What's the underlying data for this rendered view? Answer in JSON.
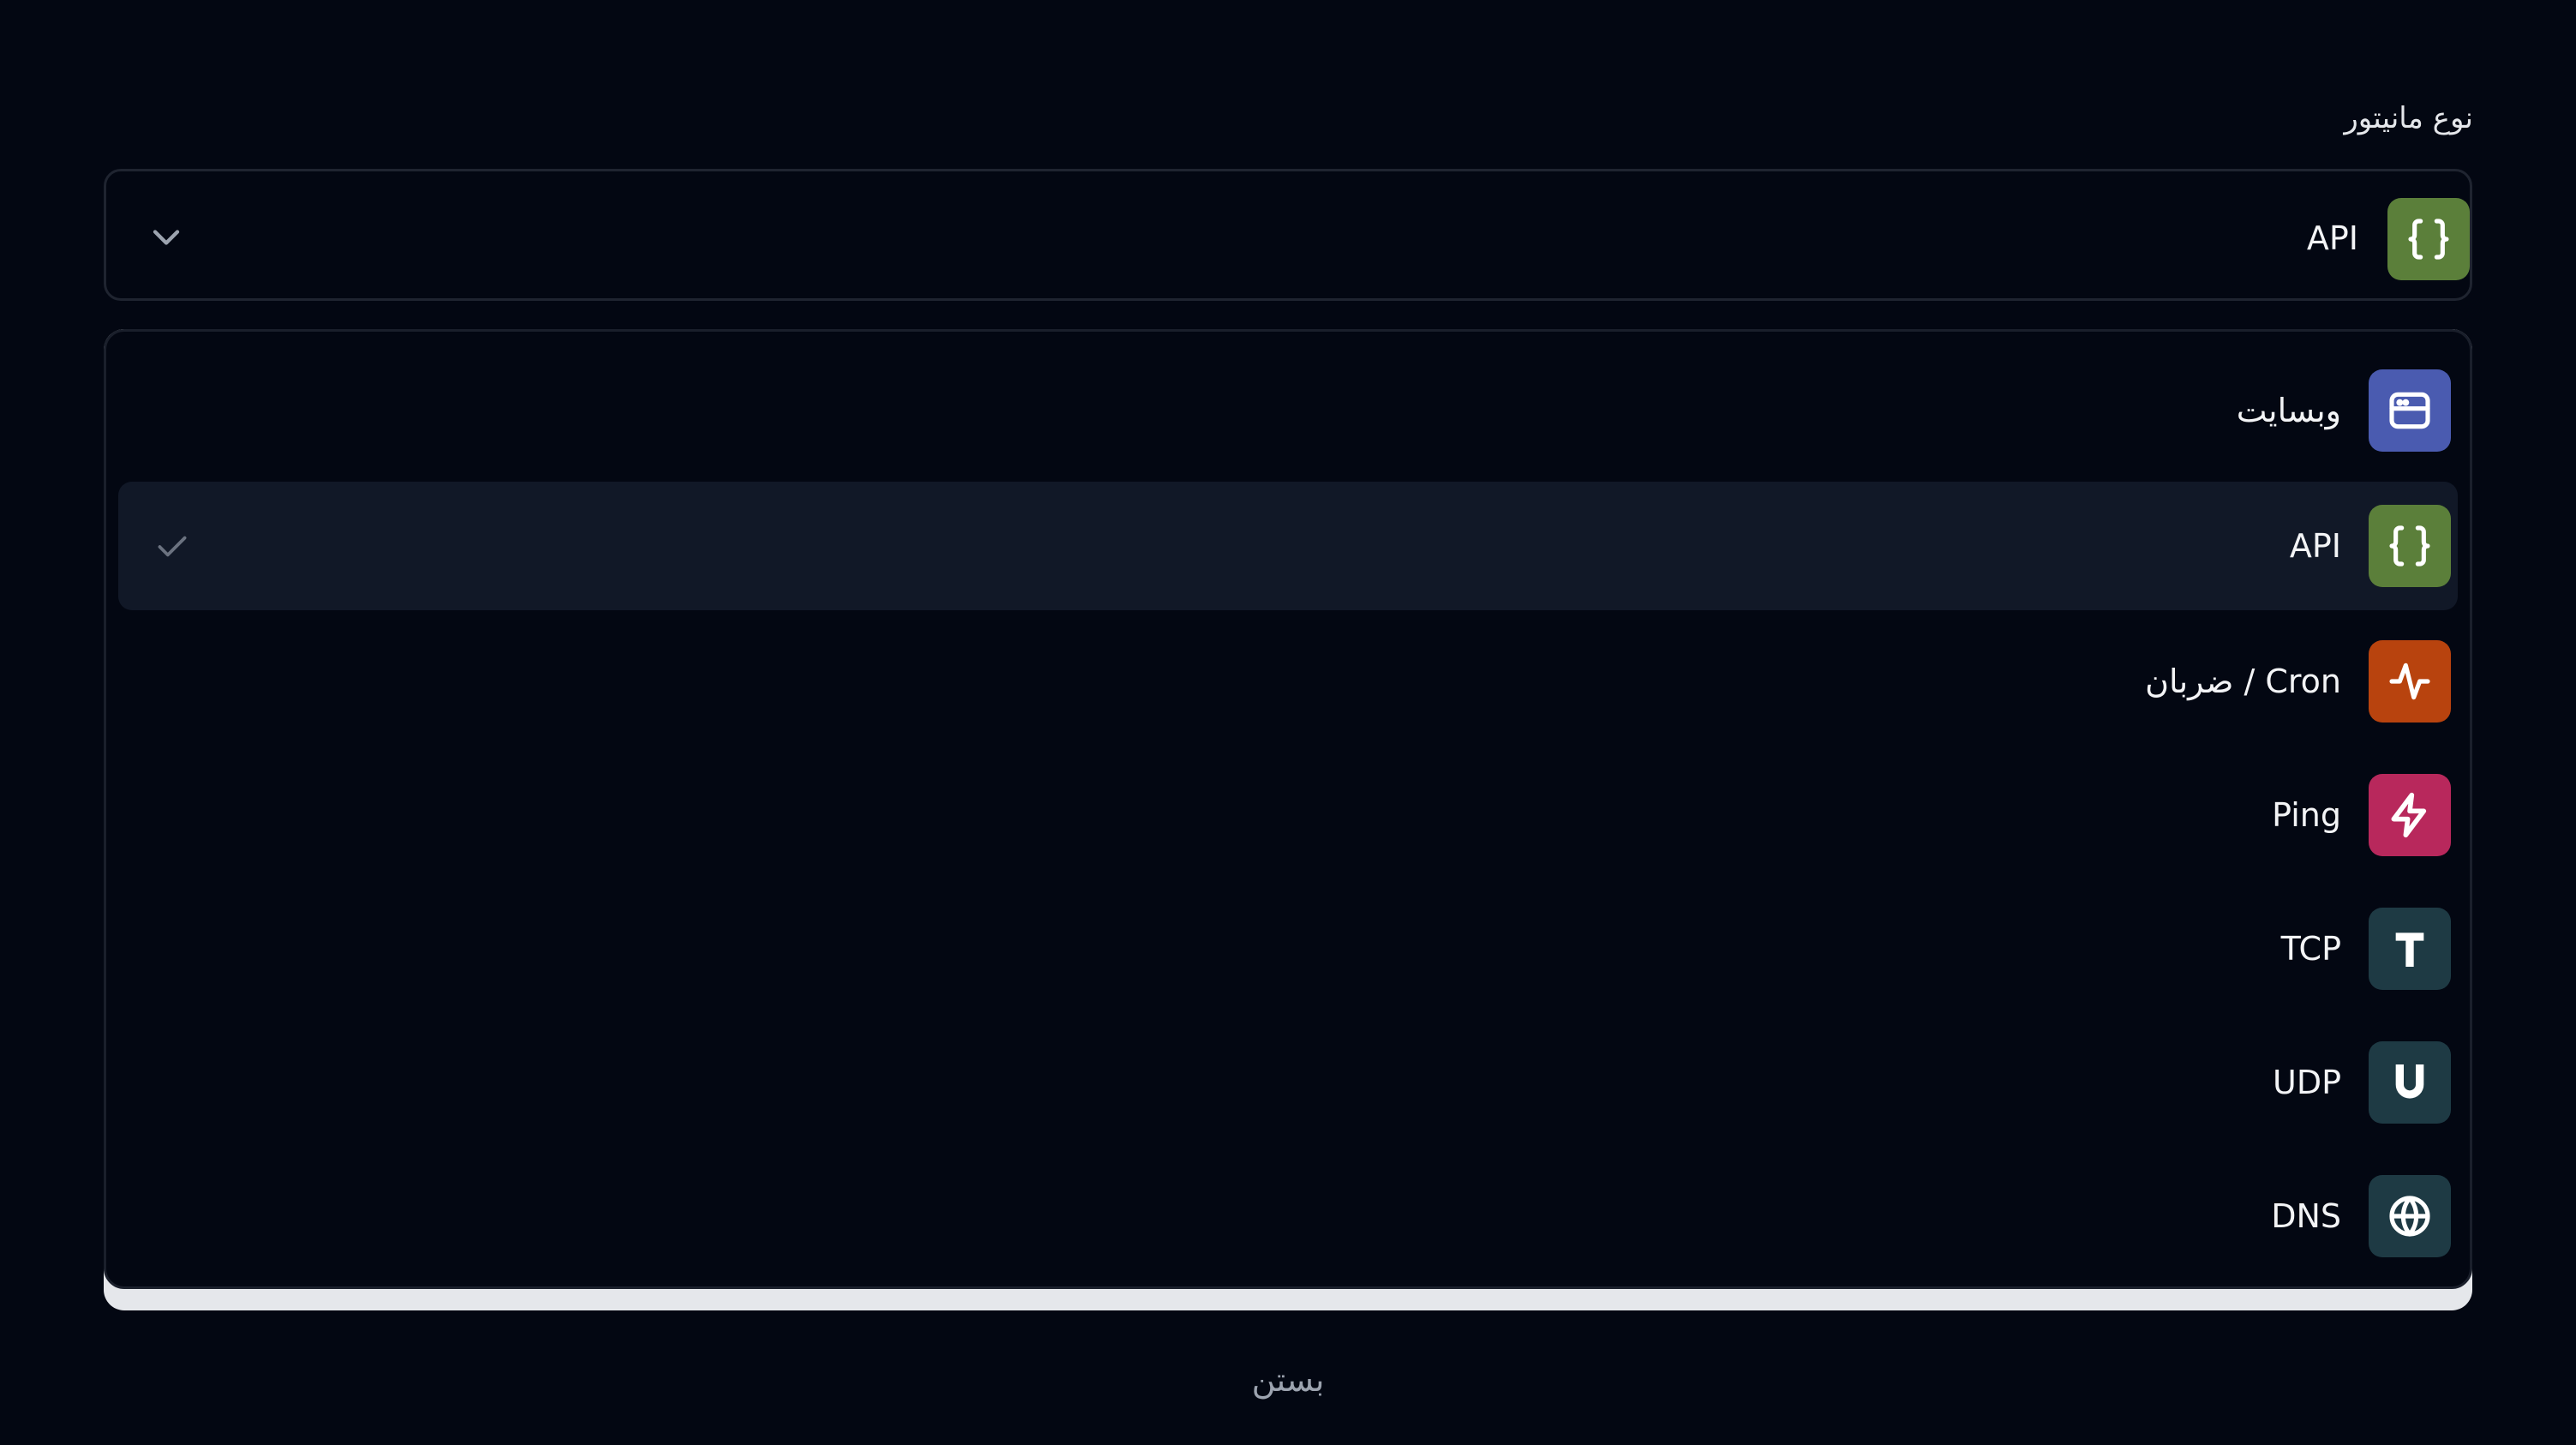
{
  "field": {
    "label": "نوع مانیتور"
  },
  "trigger": {
    "selected_label": "API",
    "icon": "braces-icon",
    "icon_color": "#5b7f3a"
  },
  "options": [
    {
      "label": "وبسایت",
      "icon": "browser-window-icon",
      "color": "#4a5bb0",
      "selected": false
    },
    {
      "label": "API",
      "icon": "braces-icon",
      "color": "#5b7f3a",
      "selected": true
    },
    {
      "label": "ضربان / Cron",
      "icon": "heartbeat-icon",
      "color": "#b8430e",
      "selected": false
    },
    {
      "label": "Ping",
      "icon": "lightning-icon",
      "color": "#b8285c",
      "selected": false
    },
    {
      "label": "TCP",
      "icon": "letter-t-icon",
      "color": "#1e3a44",
      "selected": false
    },
    {
      "label": "UDP",
      "icon": "letter-u-icon",
      "color": "#1e3a44",
      "selected": false
    },
    {
      "label": "DNS",
      "icon": "globe-icon",
      "color": "#1e3a44",
      "selected": false
    }
  ],
  "footer": {
    "close_label": "بستن"
  },
  "colors": {
    "background": "#030712",
    "selected_row": "#111827",
    "border": "#1f2430",
    "muted_text": "#9ca3af"
  }
}
